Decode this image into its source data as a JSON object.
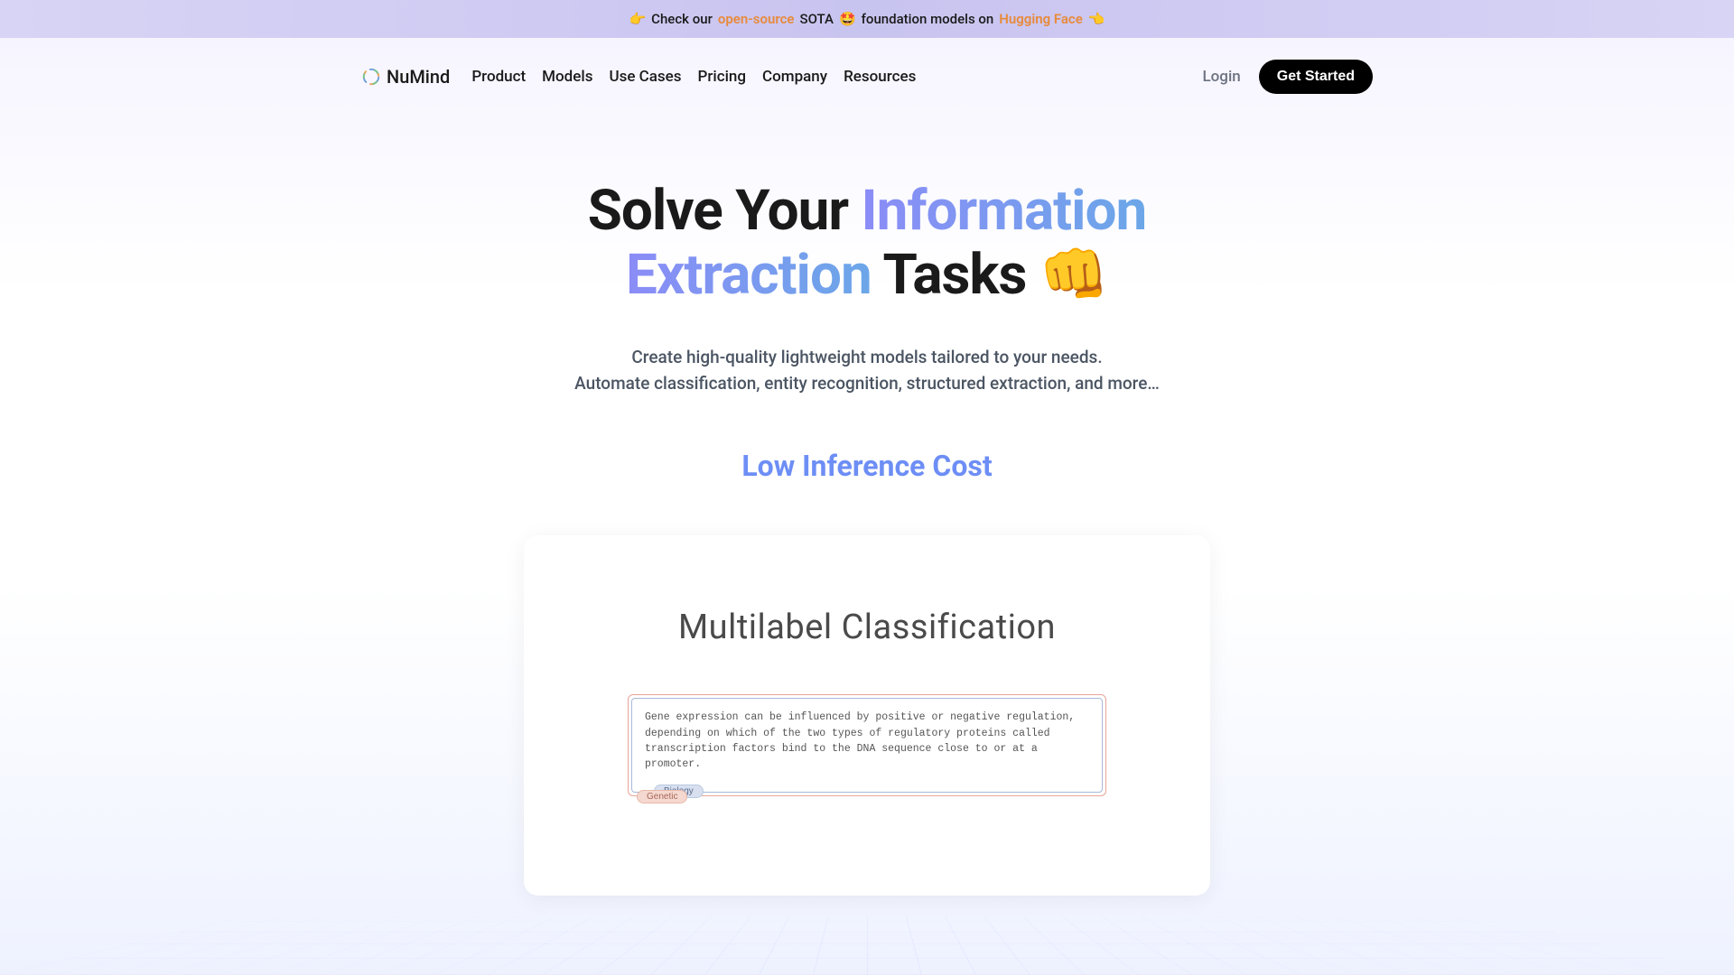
{
  "announcement": {
    "emoji_left": "👉",
    "text_1": "Check our",
    "open_source": "open-source",
    "text_2": "SOTA",
    "emoji_star": "🤩",
    "text_3": "foundation models on",
    "hugging_face": "Hugging Face",
    "emoji_right": "👈"
  },
  "logo": {
    "text": "NuMind"
  },
  "nav": {
    "items": [
      {
        "label": "Product"
      },
      {
        "label": "Models"
      },
      {
        "label": "Use Cases"
      },
      {
        "label": "Pricing"
      },
      {
        "label": "Company"
      },
      {
        "label": "Resources"
      }
    ],
    "login": "Login",
    "cta": "Get Started"
  },
  "hero": {
    "title_1": "Solve Your ",
    "title_gradient_1": "Information",
    "title_gradient_2": "Extraction",
    "title_2": " Tasks ",
    "emoji": "👊",
    "subtitle_1": "Create high-quality lightweight models tailored to your needs.",
    "subtitle_2": "Automate classification, entity recognition, structured extraction, and more…"
  },
  "feature": {
    "label": "Low Inference Cost"
  },
  "demo": {
    "title": "Multilabel Classification",
    "text": "Gene expression can be influenced by positive or negative regulation, depending on which of the two types of regulatory proteins called transcription factors bind to the DNA sequence close to or at a promoter.",
    "tag_biology": "Biology",
    "tag_genetic": "Genetic"
  }
}
